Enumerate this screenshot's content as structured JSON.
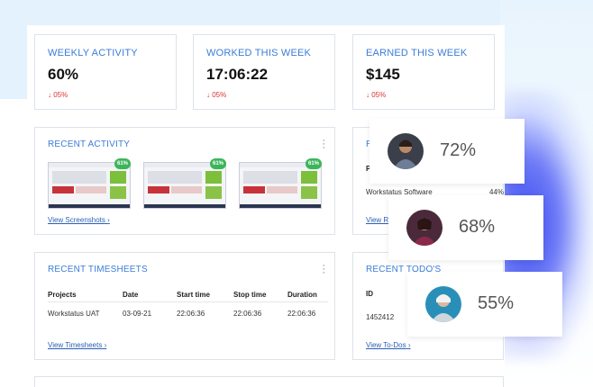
{
  "stats": [
    {
      "label": "WEEKLY ACTIVITY",
      "value": "60%",
      "change": "05%"
    },
    {
      "label": "WORKED THIS WEEK",
      "value": "17:06:22",
      "change": "05%"
    },
    {
      "label": "EARNED THIS WEEK",
      "value": "$145",
      "change": "05%"
    }
  ],
  "recent_activity": {
    "title": "RECENT ACTIVITY",
    "badges": [
      "61%",
      "61%",
      "61%"
    ],
    "view_link": "View Screenshots"
  },
  "recent_projects": {
    "title_fragment": "R",
    "col_fragment": "P",
    "row_name": "Workstatus Software",
    "row_value": "44%",
    "view_link": "View Re"
  },
  "recent_timesheets": {
    "title": "RECENT TIMESHEETS",
    "columns": [
      "Projects",
      "Date",
      "Start time",
      "Stop time",
      "Duration"
    ],
    "row": [
      "Workstatus UAT",
      "03-09-21",
      "22:06:36",
      "22:06:36",
      "22:06:36"
    ],
    "view_link": "View Timesheets"
  },
  "recent_todos": {
    "title": "RECENT TODO'S",
    "col": "ID",
    "row_id": "1452412",
    "view_link": "View To-Dos"
  },
  "performers": [
    {
      "percent": "72%",
      "avatar_color": "#3a3f4a"
    },
    {
      "percent": "68%",
      "avatar_color": "#5a2a3a"
    },
    {
      "percent": "55%",
      "avatar_color": "#2a8fb8"
    }
  ],
  "colors": {
    "accent": "#3b7dd8",
    "down": "#d33333",
    "badge": "#3cb55a"
  }
}
